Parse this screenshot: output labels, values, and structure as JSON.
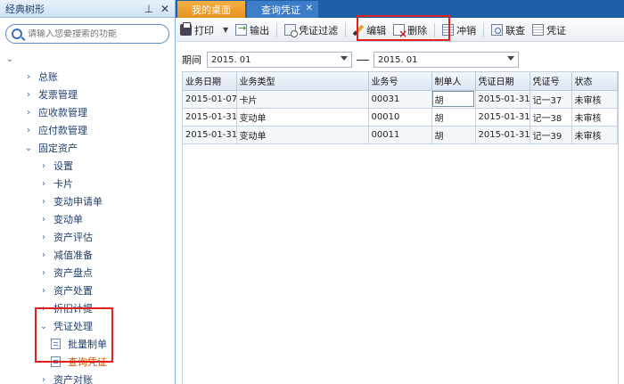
{
  "sidebar": {
    "title": "经典树形",
    "search_placeholder": "请输入您要搜索的功能",
    "tree": [
      {
        "label": "总账"
      },
      {
        "label": "发票管理"
      },
      {
        "label": "应收款管理"
      },
      {
        "label": "应付款管理"
      },
      {
        "label": "固定资产"
      },
      {
        "label": "设置"
      },
      {
        "label": "卡片"
      },
      {
        "label": "变动申请单"
      },
      {
        "label": "变动单"
      },
      {
        "label": "资产评估"
      },
      {
        "label": "减值准备"
      },
      {
        "label": "资产盘点"
      },
      {
        "label": "资产处置"
      },
      {
        "label": "折旧计提"
      },
      {
        "label": "凭证处理"
      },
      {
        "label": "批量制单"
      },
      {
        "label": "查询凭证"
      },
      {
        "label": "资产对账"
      }
    ]
  },
  "tabs": [
    {
      "label": "我的桌面"
    },
    {
      "label": "查询凭证"
    }
  ],
  "toolbar": {
    "print": "打印",
    "export": "输出",
    "filter": "凭证过滤",
    "edit": "编辑",
    "delete": "删除",
    "cancel": "冲销",
    "check": "联查",
    "voucher": "凭证"
  },
  "period": {
    "label": "期间",
    "from": "2015. 01",
    "to": "2015. 01"
  },
  "grid": {
    "columns": [
      "业务日期",
      "业务类型",
      "业务号",
      "制单人",
      "凭证日期",
      "凭证号",
      "状态"
    ],
    "rows": [
      [
        "2015-01-07",
        "卡片",
        "00031",
        "胡",
        "2015-01-31",
        "记一37",
        "未审核"
      ],
      [
        "2015-01-31",
        "变动单",
        "00010",
        "胡",
        "2015-01-31",
        "记一38",
        "未审核"
      ],
      [
        "2015-01-31",
        "变动单",
        "00011",
        "胡",
        "2015-01-31",
        "记一39",
        "未审核"
      ]
    ]
  },
  "colors": {
    "tab_bar": "#1f5fa8",
    "home_tab": "#f0a030",
    "highlight_box": "#e0211f",
    "selected_tree_text": "#d35400"
  }
}
